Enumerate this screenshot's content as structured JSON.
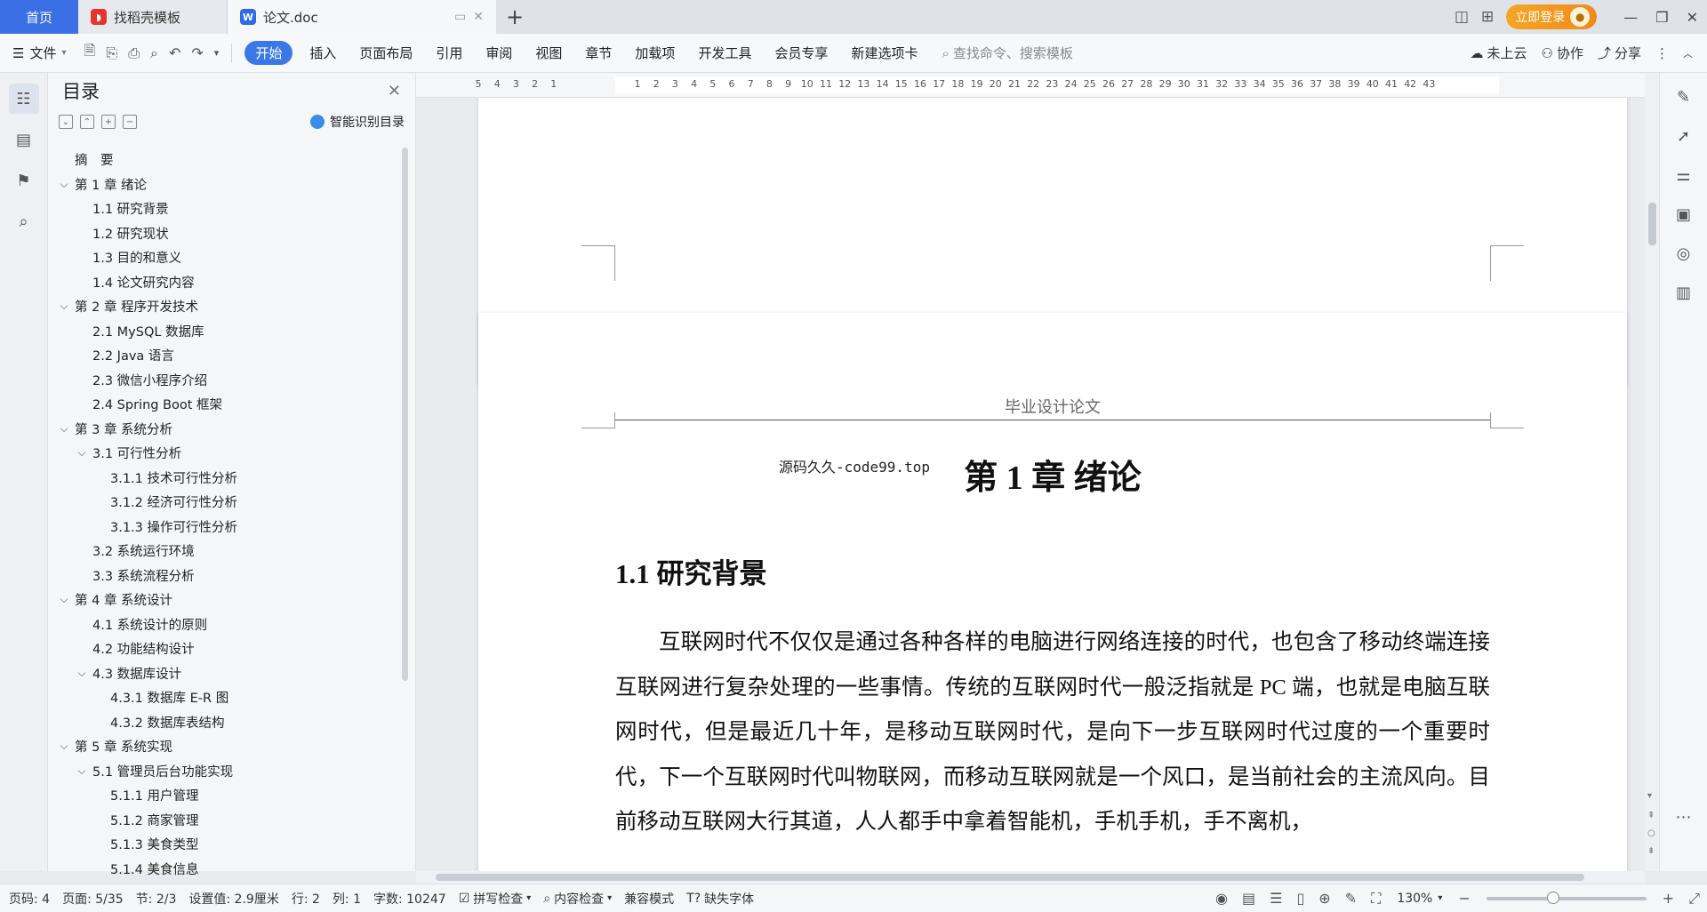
{
  "tabs": {
    "home": "首页",
    "template_tab": "找稻壳模板",
    "doc_tab": "论文.doc"
  },
  "titlebar": {
    "login": "立即登录"
  },
  "ribbon": {
    "file": "文件",
    "tabs": [
      "开始",
      "插入",
      "页面布局",
      "引用",
      "审阅",
      "视图",
      "章节",
      "加载项",
      "开发工具",
      "会员专享",
      "新建选项卡"
    ],
    "active_tab": "开始",
    "search_placeholder": "查找命令、搜索模板",
    "cloud": "未上云",
    "collab": "协作",
    "share": "分享"
  },
  "toc": {
    "title": "目录",
    "smart": "智能识别目录",
    "items": [
      {
        "text": "摘　要",
        "level": 0,
        "chev": ""
      },
      {
        "text": "第 1 章  绪论",
        "level": 0,
        "chev": "v"
      },
      {
        "text": "1.1  研究背景",
        "level": 1,
        "chev": ""
      },
      {
        "text": "1.2  研究现状",
        "level": 1,
        "chev": ""
      },
      {
        "text": "1.3  目的和意义",
        "level": 1,
        "chev": ""
      },
      {
        "text": "1.4  论文研究内容",
        "level": 1,
        "chev": ""
      },
      {
        "text": "第 2 章  程序开发技术",
        "level": 0,
        "chev": "v"
      },
      {
        "text": "2.1 MySQL 数据库",
        "level": 1,
        "chev": ""
      },
      {
        "text": "2.2 Java 语言",
        "level": 1,
        "chev": ""
      },
      {
        "text": "2.3  微信小程序介绍",
        "level": 1,
        "chev": ""
      },
      {
        "text": "2.4 Spring Boot 框架",
        "level": 1,
        "chev": ""
      },
      {
        "text": "第 3 章  系统分析",
        "level": 0,
        "chev": "v"
      },
      {
        "text": "3.1 可行性分析",
        "level": 1,
        "chev": "v"
      },
      {
        "text": "3.1.1 技术可行性分析",
        "level": 2,
        "chev": ""
      },
      {
        "text": "3.1.2 经济可行性分析",
        "level": 2,
        "chev": ""
      },
      {
        "text": "3.1.3 操作可行性分析",
        "level": 2,
        "chev": ""
      },
      {
        "text": "3.2 系统运行环境",
        "level": 1,
        "chev": ""
      },
      {
        "text": "3.3 系统流程分析",
        "level": 1,
        "chev": ""
      },
      {
        "text": "第 4 章  系统设计",
        "level": 0,
        "chev": "v"
      },
      {
        "text": "4.1  系统设计的原则",
        "level": 1,
        "chev": ""
      },
      {
        "text": "4.2  功能结构设计",
        "level": 1,
        "chev": ""
      },
      {
        "text": "4.3  数据库设计",
        "level": 1,
        "chev": "v"
      },
      {
        "text": "4.3.1  数据库 E-R 图",
        "level": 2,
        "chev": ""
      },
      {
        "text": "4.3.2  数据库表结构",
        "level": 2,
        "chev": ""
      },
      {
        "text": "第 5 章  系统实现",
        "level": 0,
        "chev": "v"
      },
      {
        "text": "5.1 管理员后台功能实现",
        "level": 1,
        "chev": "v"
      },
      {
        "text": "5.1.1  用户管理",
        "level": 2,
        "chev": ""
      },
      {
        "text": "5.1.2  商家管理",
        "level": 2,
        "chev": ""
      },
      {
        "text": "5.1.3  美食类型",
        "level": 2,
        "chev": ""
      },
      {
        "text": "5.1.4  美食信息",
        "level": 2,
        "chev": ""
      }
    ]
  },
  "ruler": {
    "left_nums": [
      "5",
      "4",
      "3",
      "2",
      "1"
    ],
    "right_nums": [
      "1",
      "2",
      "3",
      "4",
      "5",
      "6",
      "7",
      "8",
      "9",
      "10",
      "11",
      "12",
      "13",
      "14",
      "15",
      "16",
      "17",
      "18",
      "19",
      "20",
      "21",
      "22",
      "23",
      "24",
      "25",
      "26",
      "27",
      "28",
      "29",
      "30",
      "31",
      "32",
      "33",
      "34",
      "35",
      "36",
      "37",
      "38",
      "39",
      "40",
      "41",
      "42",
      "43"
    ]
  },
  "document": {
    "header": "毕业设计论文",
    "watermark": "源码久久-code99.top",
    "chapter": "第 1 章  绪论",
    "section": "1.1  研究背景",
    "paragraph": "互联网时代不仅仅是通过各种各样的电脑进行网络连接的时代，也包含了移动终端连接互联网进行复杂处理的一些事情。传统的互联网时代一般泛指就是 PC 端，也就是电脑互联网时代，但是最近几十年，是移动互联网时代，是向下一步互联网时代过度的一个重要时代，下一个互联网时代叫物联网，而移动互联网就是一个风口，是当前社会的主流风向。目前移动互联网大行其道，人人都手中拿着智能机，手机手机，手不离机，"
  },
  "status": {
    "page": "页码: 4",
    "pages": "页面: 5/35",
    "section": "节: 2/3",
    "setting": "设置值: 2.9厘米",
    "row": "行: 2",
    "col": "列: 1",
    "words": "字数: 10247",
    "spell": "拼写检查",
    "content": "内容检查",
    "compat": "兼容模式",
    "font": "缺失字体",
    "zoom": "130%",
    "zoom_level": 0.42
  }
}
